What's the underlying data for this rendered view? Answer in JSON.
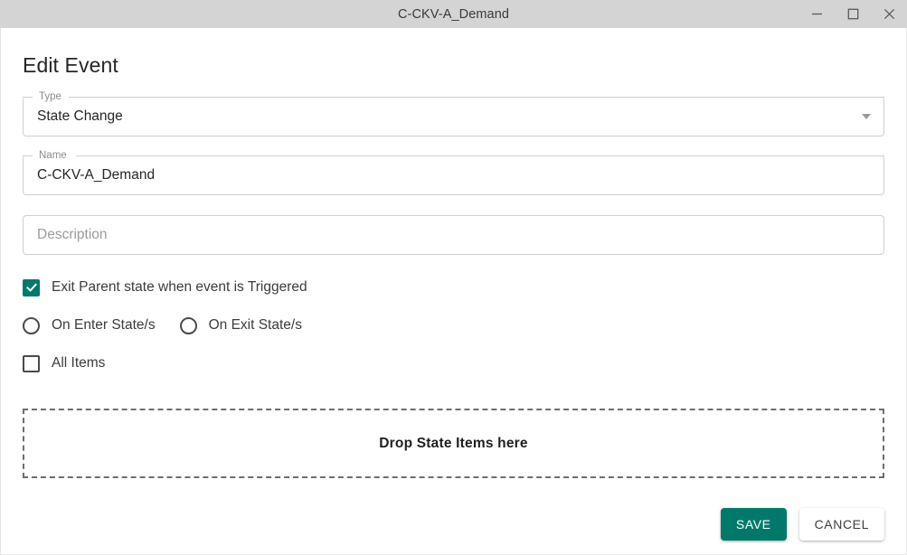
{
  "window": {
    "title": "C-CKV-A_Demand",
    "controls": {
      "minimize": "minimize-icon",
      "maximize": "maximize-icon",
      "close": "close-icon"
    }
  },
  "dialog": {
    "heading": "Edit Event",
    "fields": [
      {
        "id": "type",
        "label": "Type",
        "value": "State Change",
        "placeholder": "",
        "kind": "select",
        "arrow_icon": "chevron-down-icon"
      },
      {
        "id": "name",
        "label": "Name",
        "value": "C-CKV-A_Demand",
        "placeholder": "",
        "kind": "text"
      },
      {
        "id": "description",
        "label": "",
        "value": "",
        "placeholder": "Description",
        "kind": "text"
      }
    ],
    "options": {
      "exit_parent": {
        "label": "Exit Parent state when event is Triggered",
        "checked": true
      },
      "on_enter_state": {
        "label": "On Enter State/s",
        "selected": false
      },
      "on_exit_state": {
        "label": "On Exit State/s",
        "selected": false
      },
      "all_items": {
        "label": "All Items",
        "checked": false
      }
    },
    "dropzone": {
      "text": "Drop State Items here"
    },
    "buttons": {
      "save": "SAVE",
      "cancel": "CANCEL"
    }
  },
  "colors": {
    "accent": "#00796B",
    "titlebar": "#D4D4D4",
    "field_border": "#CFCFCF",
    "text_primary": "#262626",
    "text_secondary": "#8B8B8B",
    "dropzone_border": "#6E6E6E"
  }
}
